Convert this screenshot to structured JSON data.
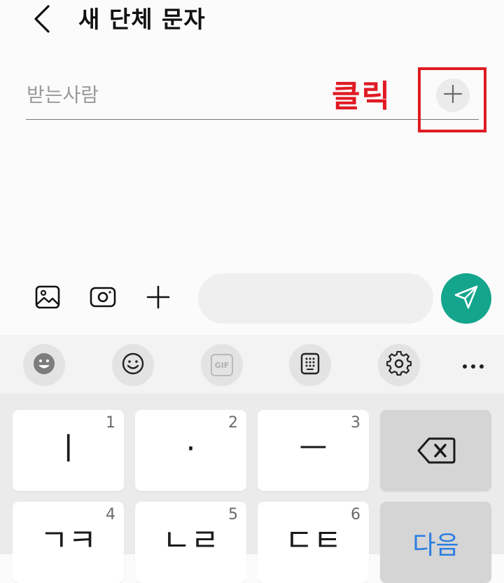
{
  "header": {
    "title": "새 단체 문자",
    "back_icon": "chevron-left-icon"
  },
  "recipient": {
    "placeholder": "받는사람",
    "add_icon": "plus-icon"
  },
  "annotation": {
    "label": "클릭",
    "color": "#e01b24"
  },
  "composer": {
    "icons": [
      "gallery-icon",
      "camera-icon",
      "plus-icon"
    ],
    "message_placeholder": "",
    "send_icon": "send-icon",
    "send_color": "#14a58d"
  },
  "keyboard_toolbar": {
    "items": [
      "emoji-face-icon",
      "smiley-icon",
      "gif-icon",
      "numeric-keypad-icon",
      "settings-icon",
      "more-icon"
    ],
    "gif_label": "GIF"
  },
  "keyboard": {
    "keys": [
      {
        "char": "ㅣ",
        "num": "1"
      },
      {
        "char": "·",
        "num": "2"
      },
      {
        "char": "ㅡ",
        "num": "3"
      },
      {
        "char": "",
        "num": "",
        "icon": "backspace-icon"
      },
      {
        "char": "ㄱㅋ",
        "num": "4"
      },
      {
        "char": "ㄴㄹ",
        "num": "5"
      },
      {
        "char": "ㄷㅌ",
        "num": "6"
      },
      {
        "char": "다음",
        "num": ""
      }
    ]
  }
}
